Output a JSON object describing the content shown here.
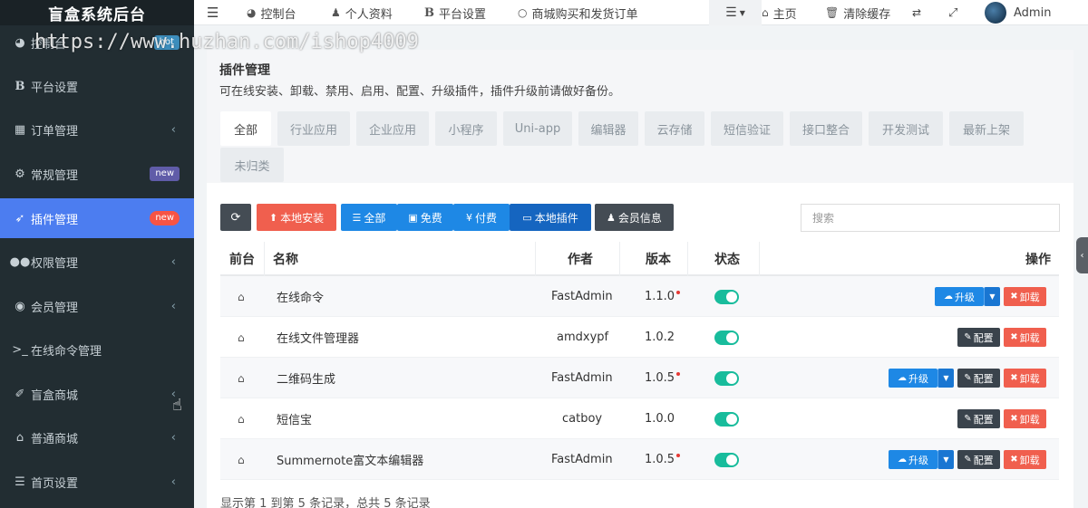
{
  "watermark": "https://www.huzhan.com/ishop4009",
  "sidebar": {
    "logo": "盲盒系统后台",
    "items": [
      {
        "label": "控制台",
        "icon": "dashboard-icon",
        "badge": "hot"
      },
      {
        "label": "平台设置",
        "icon": "bold-b-icon"
      },
      {
        "label": "订单管理",
        "icon": "calculator-icon"
      },
      {
        "label": "常规管理",
        "icon": "gears-icon",
        "badge": "new"
      },
      {
        "label": "插件管理",
        "icon": "rocket-icon",
        "badge": "new"
      },
      {
        "label": "权限管理",
        "icon": "users-icon"
      },
      {
        "label": "会员管理",
        "icon": "user-circle-icon"
      },
      {
        "label": "在线命令管理",
        "icon": "terminal-icon"
      },
      {
        "label": "盲盒商城",
        "icon": "magic-icon"
      },
      {
        "label": "普通商城",
        "icon": "bank-icon"
      },
      {
        "label": "首页设置",
        "icon": "list-icon"
      }
    ]
  },
  "topnav": {
    "items": [
      {
        "label": "控制台"
      },
      {
        "label": "个人资料"
      },
      {
        "label": "平台设置"
      },
      {
        "label": "商城购买和发货订单"
      }
    ],
    "home": "主页",
    "clear_cache": "清除缓存",
    "user": "Admin"
  },
  "panel": {
    "title": "插件管理",
    "description": "可在线安装、卸载、禁用、启用、配置、升级插件，插件升级前请做好备份。",
    "tabs": [
      "全部",
      "行业应用",
      "企业应用",
      "小程序",
      "Uni-app",
      "编辑器",
      "云存储",
      "短信验证",
      "接口整合",
      "开发测试",
      "最新上架",
      "未归类"
    ]
  },
  "toolbar": {
    "local_install": "本地安装",
    "all": "全部",
    "free": "免费",
    "paid": "付费",
    "local_plugins": "本地插件",
    "member_info": "会员信息",
    "search_placeholder": "搜索"
  },
  "table": {
    "headers": {
      "front": "前台",
      "name": "名称",
      "author": "作者",
      "version": "版本",
      "status": "状态",
      "actions": "操作"
    },
    "rows": [
      {
        "name": "在线命令",
        "author": "FastAdmin",
        "version": "1.1.0",
        "update_dot": true,
        "upgrade": true,
        "config": false
      },
      {
        "name": "在线文件管理器",
        "author": "amdxypf",
        "version": "1.0.2",
        "update_dot": false,
        "upgrade": false,
        "config": true
      },
      {
        "name": "二维码生成",
        "author": "FastAdmin",
        "version": "1.0.5",
        "update_dot": true,
        "upgrade": true,
        "config": true
      },
      {
        "name": "短信宝",
        "author": "catboy",
        "version": "1.0.0",
        "update_dot": false,
        "upgrade": false,
        "config": true
      },
      {
        "name": "Summernote富文本编辑器",
        "author": "FastAdmin",
        "version": "1.0.5",
        "update_dot": true,
        "upgrade": true,
        "config": true
      }
    ],
    "upgrade_label": "升级",
    "config_label": "配置",
    "uninstall_label": "卸载"
  },
  "footer": "显示第 1 到第 5 条记录，总共 5 条记录"
}
